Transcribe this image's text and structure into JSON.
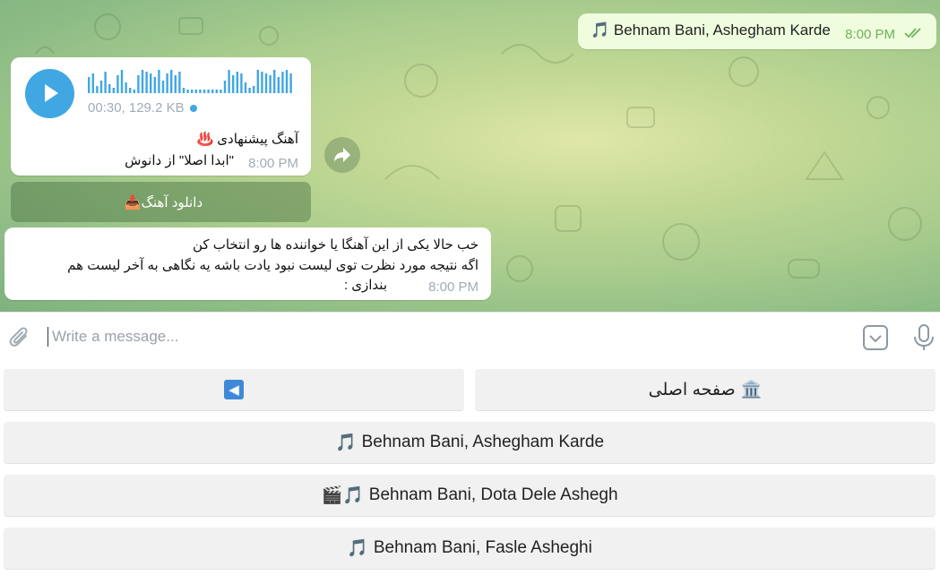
{
  "colors": {
    "accent": "#40a7e3",
    "out_bubble": "#effdde",
    "out_time": "#6cb356",
    "time": "#a0acb6"
  },
  "messages": {
    "outgoing": {
      "text": "🎵 Behnam Bani, Ashegham Karde",
      "time": "8:00 PM"
    },
    "audio": {
      "meta": "00:30, 129.2 KB",
      "caption_line1": "آهنگ پیشنهادی ♨️",
      "caption_line2": "\"ابدا اصلا\" از دانوش",
      "time": "8:00 PM",
      "inline_button": {
        "label": "دانلود آهنگ",
        "icon": "📥"
      }
    },
    "text": {
      "lines": [
        "خب حالا یکی از این آهنگا یا خواننده ها رو انتخاب کن",
        "اگه نتیجه مورد نظرت توی لیست نبود یادت باشه یه نگاهی به آخر لیست هم",
        "بندازی :"
      ],
      "time": "8:00 PM"
    }
  },
  "input": {
    "placeholder": "Write a message..."
  },
  "icons": {
    "attach": "paperclip-icon",
    "keyboard": "keyboard-toggle-icon",
    "mic": "microphone-icon",
    "forward": "forward-icon",
    "play": "play-icon"
  },
  "keyboard": {
    "back": {
      "icon": "⬅️"
    },
    "home": {
      "icon": "🏛️",
      "label": "صفحه اصلی"
    },
    "songs": [
      {
        "icon": "🎵",
        "label": "Behnam Bani, Ashegham Karde"
      },
      {
        "icon": "🎬🎵",
        "label": "Behnam Bani, Dota Dele Ashegh"
      },
      {
        "icon": "🎵",
        "label": "Behnam Bani, Fasle Asheghi"
      }
    ]
  }
}
